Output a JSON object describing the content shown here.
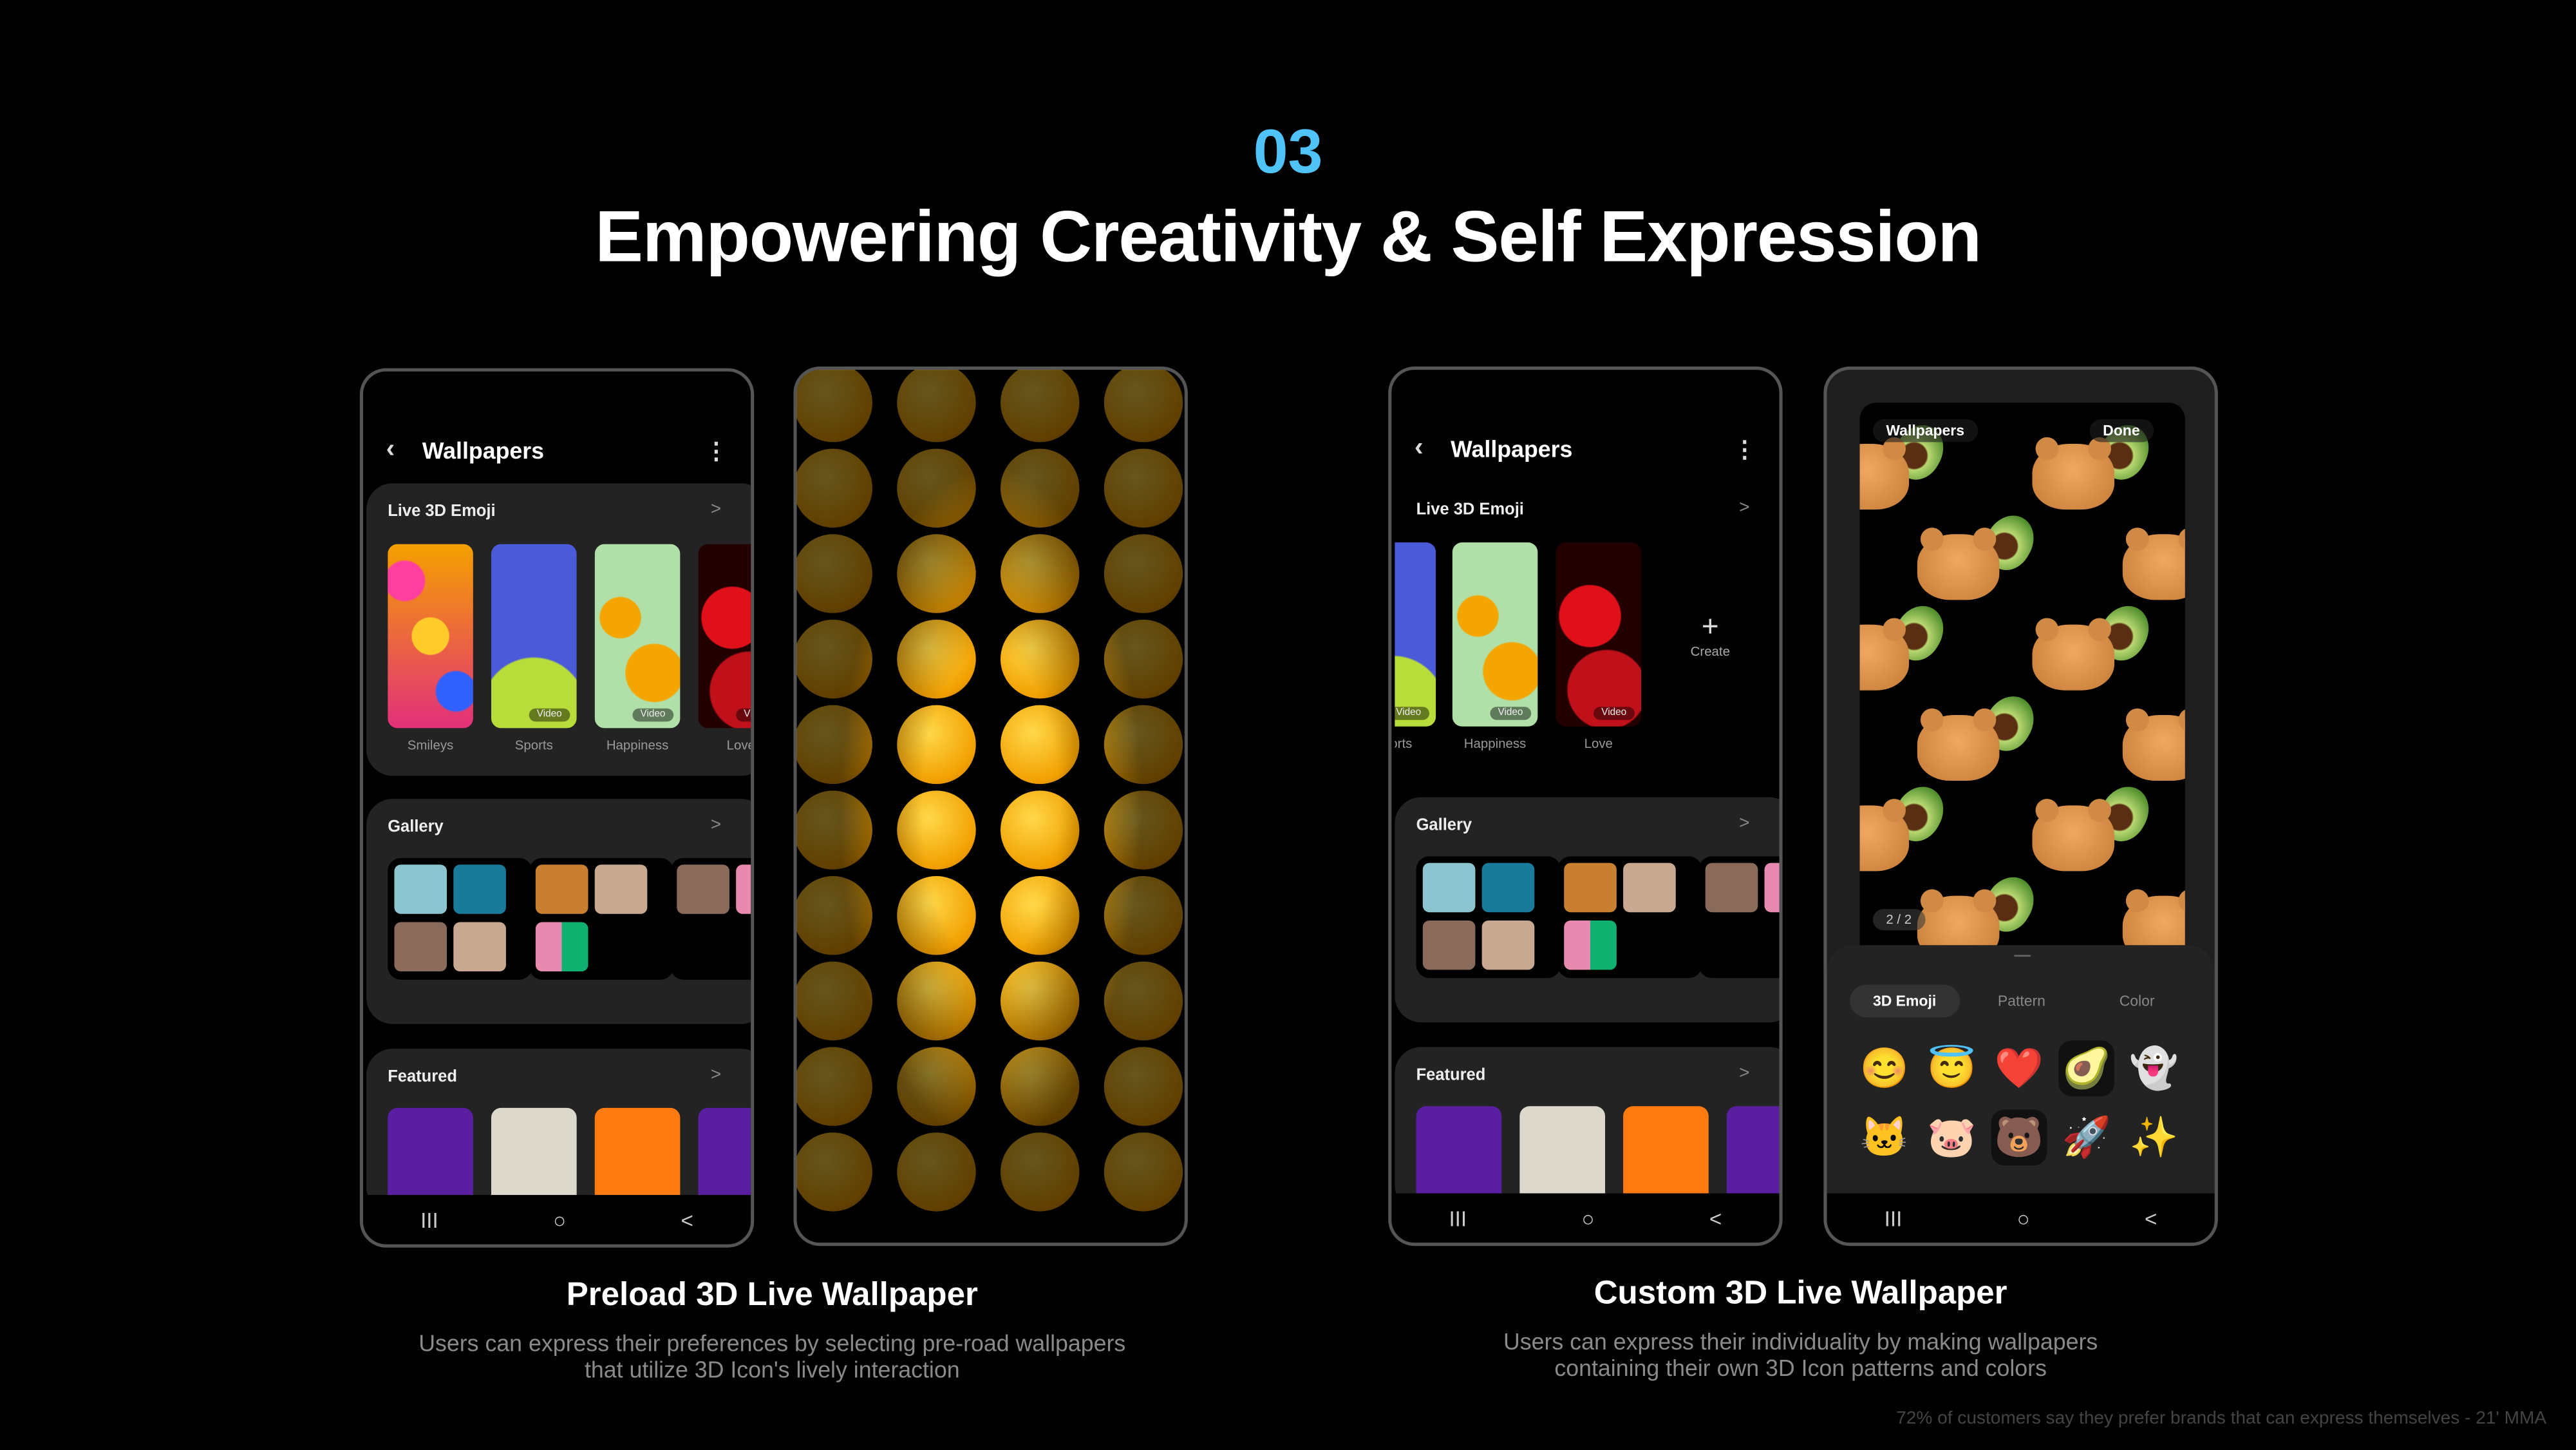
{
  "section_number": "03",
  "headline": "Empowering Creativity & Self Expression",
  "colors": {
    "accent": "#4fc3f7",
    "background": "#000000",
    "card": "#232323"
  },
  "phone1": {
    "title": "Wallpapers",
    "back_icon": "chevron-left",
    "menu_icon": "more-vertical",
    "live": {
      "title": "Live 3D Emoji",
      "items": [
        {
          "label": "Smileys"
        },
        {
          "label": "Sports",
          "badge": "Video"
        },
        {
          "label": "Happiness",
          "badge": "Video"
        },
        {
          "label": "Love",
          "badge": "Video"
        }
      ]
    },
    "gallery": {
      "title": "Gallery"
    },
    "featured": {
      "title": "Featured"
    }
  },
  "phone3": {
    "title": "Wallpapers",
    "live": {
      "title": "Live 3D Emoji",
      "items": [
        {
          "label": "Sports",
          "badge": "Video"
        },
        {
          "label": "Happiness",
          "badge": "Video"
        },
        {
          "label": "Love",
          "badge": "Video"
        }
      ],
      "create_label": "Create"
    },
    "gallery": {
      "title": "Gallery"
    },
    "featured": {
      "title": "Featured"
    }
  },
  "phone4": {
    "back_label": "Wallpapers",
    "done_label": "Done",
    "page_indicator": "2 / 2",
    "tabs": [
      {
        "label": "3D Emoji",
        "active": true
      },
      {
        "label": "Pattern"
      },
      {
        "label": "Color"
      }
    ],
    "emoji": [
      "😊",
      "😇",
      "❤️",
      "🥑",
      "👻",
      "🐱",
      "🐷",
      "🐻",
      "🚀",
      "✨"
    ],
    "selected": [
      "🥑",
      "🐻"
    ]
  },
  "nav": {
    "recents": "III",
    "home": "○",
    "back": "<"
  },
  "left_caption": {
    "title": "Preload 3D Live Wallpaper",
    "line1": "Users can express their preferences by selecting pre-road wallpapers",
    "line2": "that utilize 3D Icon's lively interaction"
  },
  "right_caption": {
    "title": "Custom 3D Live Wallpaper",
    "line1": "Users can express their individuality by making wallpapers",
    "line2": "containing their own 3D Icon patterns and colors"
  },
  "footnote": "72% of customers say they prefer brands that can express themselves - 21' MMA"
}
